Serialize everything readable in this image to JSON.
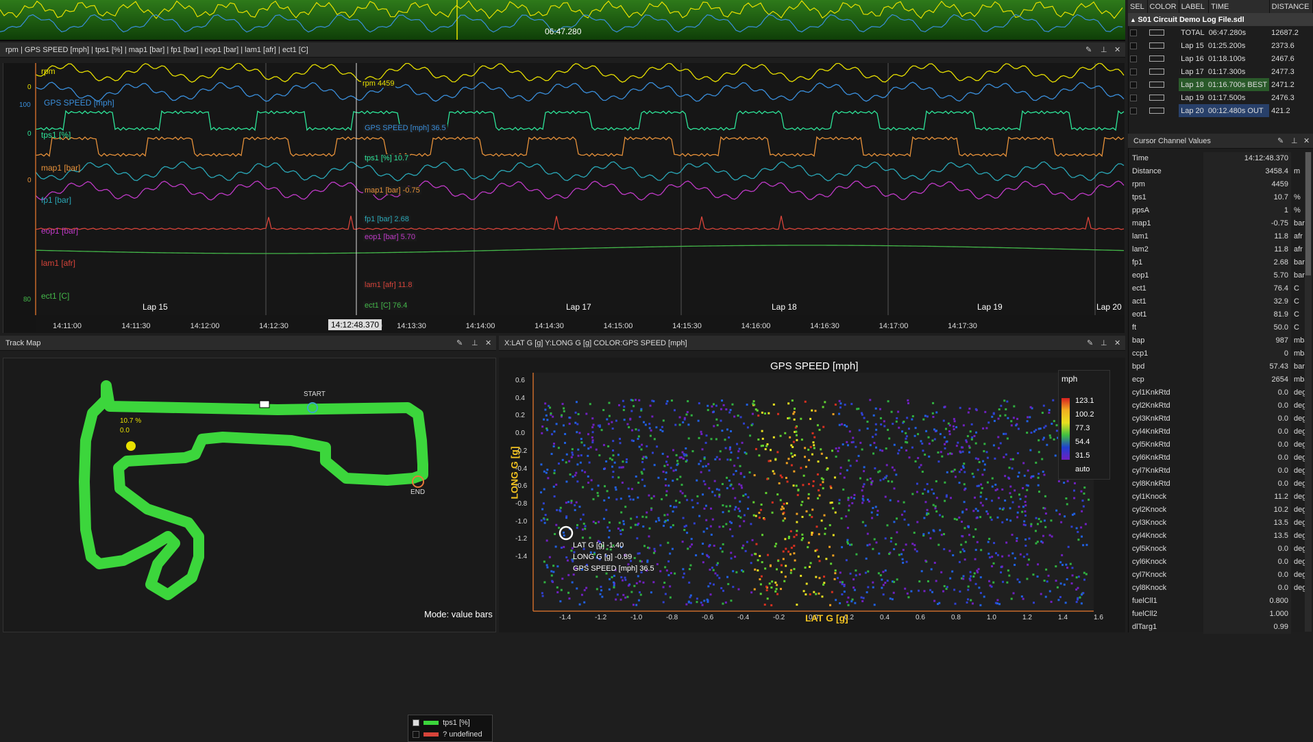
{
  "overview": {
    "time": "06:47.280"
  },
  "graph_panel": {
    "title": "rpm  |  GPS SPEED [mph]  |  tps1 [%]  |  map1 [bar]  |  fp1 [bar]  |  eop1 [bar]  |  lam1 [afr]  |  ect1 [C]",
    "channels": [
      {
        "label": "rpm",
        "color": "#e8e000",
        "cursor": "rpm 4459",
        "axis": "0"
      },
      {
        "label": "GPS SPEED [mph]",
        "color": "#3a8fdc",
        "cursor": "GPS SPEED [mph] 36.5",
        "axis": "100"
      },
      {
        "label": "tps1 [%]",
        "color": "#2ee69a",
        "cursor": "tps1 [%] 10.7",
        "axis": "0"
      },
      {
        "label": "map1 [bar]",
        "color": "#e8923a",
        "cursor": "map1 [bar] -0.75",
        "axis": "0"
      },
      {
        "label": "fp1 [bar]",
        "color": "#2aa8b8",
        "cursor": "fp1 [bar] 2.68",
        "axis": ""
      },
      {
        "label": "eop1 [bar]",
        "color": "#c03ac8",
        "cursor": "eop1 [bar] 5.70",
        "axis": ""
      },
      {
        "label": "lam1 [afr]",
        "color": "#d8443a",
        "cursor": "lam1 [afr] 11.8",
        "axis": ""
      },
      {
        "label": "ect1 [C]",
        "color": "#44b84a",
        "cursor": "ect1 [C] 76.4",
        "axis": "80"
      }
    ],
    "laps": [
      "Lap 15",
      "Lap 17",
      "Lap 18",
      "Lap 19",
      "Lap 20"
    ],
    "time_ticks": [
      "14:11:00",
      "14:11:30",
      "14:12:00",
      "14:12:30",
      "13:00",
      "14:13:30",
      "14:14:00",
      "14:14:30",
      "14:15:00",
      "14:15:30",
      "14:16:00",
      "14:16:30",
      "14:17:00",
      "14:17:30"
    ],
    "cursor_time": "14:12:48.370"
  },
  "lap_table": {
    "headers": [
      "SEL",
      "COLOR",
      "LABEL",
      "TIME",
      "DISTANCE"
    ],
    "file": "S01  Circuit Demo Log File.sdl",
    "rows": [
      {
        "label": "TOTAL",
        "time": "06:47.280s",
        "distance": "12687.2"
      },
      {
        "label": "Lap 15",
        "time": "01:25.200s",
        "distance": "2373.6"
      },
      {
        "label": "Lap 16",
        "time": "01:18.100s",
        "distance": "2467.6"
      },
      {
        "label": "Lap 17",
        "time": "01:17.300s",
        "distance": "2477.3"
      },
      {
        "label": "Lap 18",
        "time": "01:16.700s BEST",
        "distance": "2471.2"
      },
      {
        "label": "Lap 19",
        "time": "01:17.500s",
        "distance": "2476.3"
      },
      {
        "label": "Lap 20",
        "time": "00:12.480s OUT",
        "distance": "421.2"
      }
    ]
  },
  "cursor_values": {
    "title": "Cursor Channel Values",
    "rows": [
      [
        "Time",
        "14:12:48.370",
        ""
      ],
      [
        "Distance",
        "3458.4",
        "m"
      ],
      [
        "rpm",
        "4459",
        ""
      ],
      [
        "tps1",
        "10.7",
        "%"
      ],
      [
        "ppsA",
        "1",
        "%"
      ],
      [
        "map1",
        "-0.75",
        "bar"
      ],
      [
        "lam1",
        "11.8",
        "afr"
      ],
      [
        "lam2",
        "11.8",
        "afr"
      ],
      [
        "fp1",
        "2.68",
        "bar"
      ],
      [
        "eop1",
        "5.70",
        "bar"
      ],
      [
        "ect1",
        "76.4",
        "C"
      ],
      [
        "act1",
        "32.9",
        "C"
      ],
      [
        "eot1",
        "81.9",
        "C"
      ],
      [
        "ft",
        "50.0",
        "C"
      ],
      [
        "bap",
        "987",
        "mbar"
      ],
      [
        "ccp1",
        "0",
        "mbar"
      ],
      [
        "bpd",
        "57.43",
        "bar"
      ],
      [
        "ecp",
        "2654",
        "mbar"
      ],
      [
        "cyl1KnkRtd",
        "0.0",
        "deg"
      ],
      [
        "cyl2KnkRtd",
        "0.0",
        "deg"
      ],
      [
        "cyl3KnkRtd",
        "0.0",
        "deg"
      ],
      [
        "cyl4KnkRtd",
        "0.0",
        "deg"
      ],
      [
        "cyl5KnkRtd",
        "0.0",
        "deg"
      ],
      [
        "cyl6KnkRtd",
        "0.0",
        "deg"
      ],
      [
        "cyl7KnkRtd",
        "0.0",
        "deg"
      ],
      [
        "cyl8KnkRtd",
        "0.0",
        "deg"
      ],
      [
        "cyl1Knock",
        "11.2",
        "deg"
      ],
      [
        "cyl2Knock",
        "10.2",
        "deg"
      ],
      [
        "cyl3Knock",
        "13.5",
        "deg"
      ],
      [
        "cyl4Knock",
        "13.5",
        "deg"
      ],
      [
        "cyl5Knock",
        "0.0",
        "deg"
      ],
      [
        "cyl6Knock",
        "0.0",
        "deg"
      ],
      [
        "cyl7Knock",
        "0.0",
        "deg"
      ],
      [
        "cyl8Knock",
        "0.0",
        "deg"
      ],
      [
        "fuelCll1",
        "0.800",
        ""
      ],
      [
        "fuelCll2",
        "1.000",
        ""
      ],
      [
        "dlTarg1",
        "0.99",
        ""
      ]
    ]
  },
  "track_map": {
    "title": "Track Map",
    "legend": [
      "tps1 [%]",
      "? undefined"
    ],
    "start": "START",
    "end": "END",
    "marker_value": "10.7 %",
    "marker_value2": "0.0",
    "mode": "Mode: value bars"
  },
  "scatter": {
    "header": "X:LAT G [g]   Y:LONG G [g]   COLOR:GPS SPEED [mph]",
    "title": "GPS SPEED [mph]",
    "xlabel": "LAT G [g]",
    "ylabel": "LONG G [g]",
    "xticks": [
      "-1.4",
      "-1.2",
      "-1.0",
      "-0.8",
      "-0.6",
      "-0.4",
      "-0.2",
      "0.0",
      "0.2",
      "0.4",
      "0.6",
      "0.8",
      "1.0",
      "1.2",
      "1.4",
      "1.6"
    ],
    "yticks": [
      "0.6",
      "0.4",
      "0.2",
      "0.0",
      "-0.2",
      "-0.4",
      "-0.6",
      "-0.8",
      "-1.0",
      "-1.2",
      "-1.4"
    ],
    "colorbar_unit": "mph",
    "colorbar_ticks": [
      "123.1",
      "100.2",
      "77.3",
      "54.4",
      "31.5",
      "auto"
    ],
    "cursor_readout": [
      "LAT G [g] -1.40",
      "LONG G [g] -0.89",
      "GPS SPEED [mph] 36.5"
    ]
  }
}
